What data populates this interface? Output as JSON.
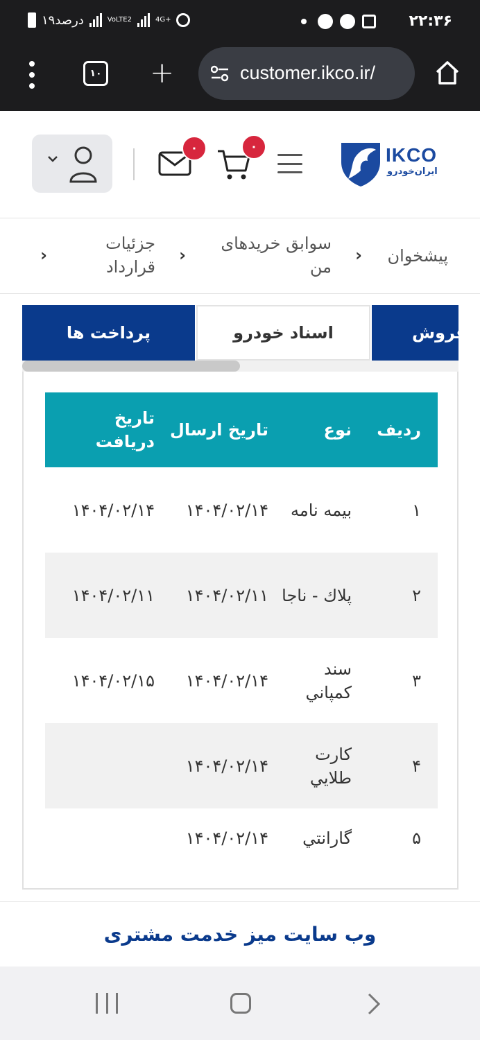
{
  "status_bar": {
    "time": "۲۲:۳۶",
    "battery": "۱۹درصد",
    "network_label": "VoLTE2",
    "network_type": "4G+"
  },
  "browser": {
    "url": "customer.ikco.ir/",
    "tab_count": "۱۰"
  },
  "header": {
    "logo_text": "IKCO",
    "logo_subtext": "ایران‌خودرو",
    "mail_badge": "۰",
    "cart_badge": "۰",
    "colors": {
      "badge": "#d7263d",
      "brand": "#0a3a8c"
    }
  },
  "breadcrumb": {
    "items": [
      "پیشخوان",
      "سوابق خریدهای من",
      "جزئیات قرارداد"
    ]
  },
  "tabs": [
    {
      "label": "فروش",
      "active": false
    },
    {
      "label": "اسناد خودرو",
      "active": true
    },
    {
      "label": "پرداخت ها",
      "active": false
    }
  ],
  "table": {
    "headers": [
      "ردیف",
      "نوع",
      "تاریخ ارسال",
      "تاریخ دریافت"
    ],
    "rows": [
      {
        "index": "۱",
        "type": "بیمه نامه",
        "sent": "۱۴۰۴/۰۲/۱۴",
        "received": "۱۴۰۴/۰۲/۱۴"
      },
      {
        "index": "۲",
        "type": "پلاك - ناجا",
        "sent": "۱۴۰۴/۰۲/۱۱",
        "received": "۱۴۰۴/۰۲/۱۱"
      },
      {
        "index": "۳",
        "type": "سند كمپاني",
        "sent": "۱۴۰۴/۰۲/۱۴",
        "received": "۱۴۰۴/۰۲/۱۵"
      },
      {
        "index": "۴",
        "type": "كارت طلايي",
        "sent": "۱۴۰۴/۰۲/۱۴",
        "received": ""
      },
      {
        "index": "۵",
        "type": "گارانتي",
        "sent": "۱۴۰۴/۰۲/۱۴",
        "received": ""
      }
    ],
    "colors": {
      "header_bg": "#0a9fb0",
      "alt_row": "#f1f1f1"
    }
  },
  "footer": {
    "link": "وب سایت میز خدمت مشتری"
  }
}
